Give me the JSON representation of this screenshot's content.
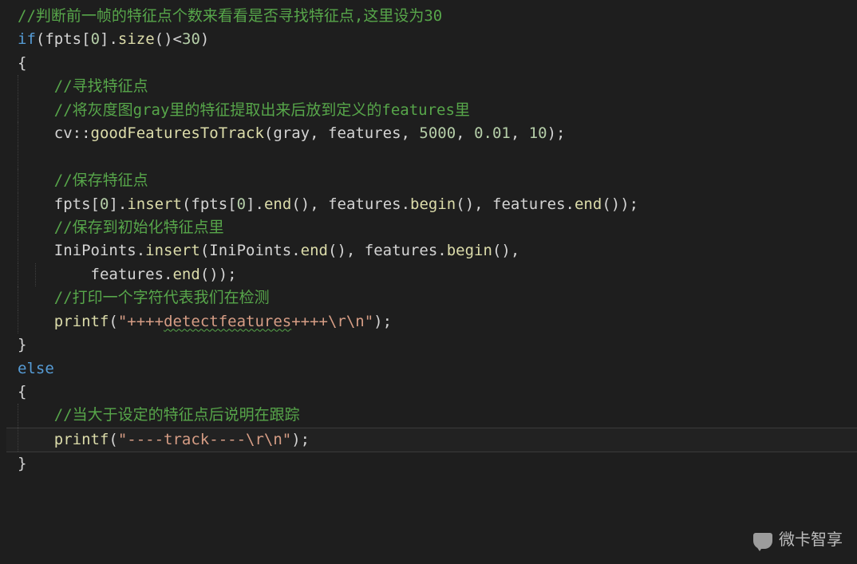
{
  "watermark": "微卡智享",
  "lines": [
    {
      "indent": 0,
      "tokens": [
        {
          "cls": "comment",
          "t": "//判断前一帧的特征点个数来看看是否寻找特征点,这里设为30"
        }
      ]
    },
    {
      "indent": 0,
      "tokens": [
        {
          "cls": "keyword",
          "t": "if"
        },
        {
          "cls": "punct",
          "t": "("
        },
        {
          "cls": "ident",
          "t": "fpts"
        },
        {
          "cls": "punct",
          "t": "["
        },
        {
          "cls": "number",
          "t": "0"
        },
        {
          "cls": "punct",
          "t": "]."
        },
        {
          "cls": "func",
          "t": "size"
        },
        {
          "cls": "punct",
          "t": "()<"
        },
        {
          "cls": "number",
          "t": "30"
        },
        {
          "cls": "punct",
          "t": ")"
        }
      ]
    },
    {
      "indent": 0,
      "tokens": [
        {
          "cls": "punct",
          "t": "{"
        }
      ]
    },
    {
      "indent": 1,
      "tokens": [
        {
          "cls": "comment",
          "t": "//寻找特征点"
        }
      ]
    },
    {
      "indent": 1,
      "tokens": [
        {
          "cls": "comment",
          "t": "//将灰度图gray里的特征提取出来后放到定义的features里"
        }
      ]
    },
    {
      "indent": 1,
      "tokens": [
        {
          "cls": "ident",
          "t": "cv"
        },
        {
          "cls": "punct",
          "t": "::"
        },
        {
          "cls": "func",
          "t": "goodFeaturesToTrack"
        },
        {
          "cls": "punct",
          "t": "("
        },
        {
          "cls": "ident",
          "t": "gray"
        },
        {
          "cls": "punct",
          "t": ", "
        },
        {
          "cls": "ident",
          "t": "features"
        },
        {
          "cls": "punct",
          "t": ", "
        },
        {
          "cls": "number",
          "t": "5000"
        },
        {
          "cls": "punct",
          "t": ", "
        },
        {
          "cls": "number",
          "t": "0.01"
        },
        {
          "cls": "punct",
          "t": ", "
        },
        {
          "cls": "number",
          "t": "10"
        },
        {
          "cls": "punct",
          "t": ");"
        }
      ]
    },
    {
      "indent": 1,
      "tokens": []
    },
    {
      "indent": 1,
      "tokens": [
        {
          "cls": "comment",
          "t": "//保存特征点"
        }
      ]
    },
    {
      "indent": 1,
      "tokens": [
        {
          "cls": "ident",
          "t": "fpts"
        },
        {
          "cls": "punct",
          "t": "["
        },
        {
          "cls": "number",
          "t": "0"
        },
        {
          "cls": "punct",
          "t": "]."
        },
        {
          "cls": "func",
          "t": "insert"
        },
        {
          "cls": "punct",
          "t": "("
        },
        {
          "cls": "ident",
          "t": "fpts"
        },
        {
          "cls": "punct",
          "t": "["
        },
        {
          "cls": "number",
          "t": "0"
        },
        {
          "cls": "punct",
          "t": "]."
        },
        {
          "cls": "func",
          "t": "end"
        },
        {
          "cls": "punct",
          "t": "(), "
        },
        {
          "cls": "ident",
          "t": "features"
        },
        {
          "cls": "punct",
          "t": "."
        },
        {
          "cls": "func",
          "t": "begin"
        },
        {
          "cls": "punct",
          "t": "(), "
        },
        {
          "cls": "ident",
          "t": "features"
        },
        {
          "cls": "punct",
          "t": "."
        },
        {
          "cls": "func",
          "t": "end"
        },
        {
          "cls": "punct",
          "t": "());"
        }
      ]
    },
    {
      "indent": 1,
      "tokens": [
        {
          "cls": "comment",
          "t": "//保存到初始化特征点里"
        }
      ]
    },
    {
      "indent": 1,
      "tokens": [
        {
          "cls": "ident",
          "t": "IniPoints"
        },
        {
          "cls": "punct",
          "t": "."
        },
        {
          "cls": "func",
          "t": "insert"
        },
        {
          "cls": "punct",
          "t": "("
        },
        {
          "cls": "ident",
          "t": "IniPoints"
        },
        {
          "cls": "punct",
          "t": "."
        },
        {
          "cls": "func",
          "t": "end"
        },
        {
          "cls": "punct",
          "t": "(), "
        },
        {
          "cls": "ident",
          "t": "features"
        },
        {
          "cls": "punct",
          "t": "."
        },
        {
          "cls": "func",
          "t": "begin"
        },
        {
          "cls": "punct",
          "t": "(),"
        }
      ]
    },
    {
      "indent": 2,
      "tokens": [
        {
          "cls": "ident",
          "t": "features"
        },
        {
          "cls": "punct",
          "t": "."
        },
        {
          "cls": "func",
          "t": "end"
        },
        {
          "cls": "punct",
          "t": "());"
        }
      ]
    },
    {
      "indent": 1,
      "tokens": [
        {
          "cls": "comment",
          "t": "//打印一个字符代表我们在检测"
        }
      ]
    },
    {
      "indent": 1,
      "tokens": [
        {
          "cls": "func",
          "t": "printf"
        },
        {
          "cls": "punct",
          "t": "("
        },
        {
          "cls": "string",
          "t": "\"++++"
        },
        {
          "cls": "string squiggle",
          "t": "detectfeatures"
        },
        {
          "cls": "string",
          "t": "++++\\r\\n\""
        },
        {
          "cls": "punct",
          "t": ");"
        }
      ]
    },
    {
      "indent": 0,
      "tokens": [
        {
          "cls": "punct",
          "t": "}"
        }
      ]
    },
    {
      "indent": 0,
      "tokens": [
        {
          "cls": "keyword",
          "t": "else"
        }
      ]
    },
    {
      "indent": 0,
      "tokens": [
        {
          "cls": "punct",
          "t": "{"
        }
      ]
    },
    {
      "indent": 1,
      "tokens": [
        {
          "cls": "comment",
          "t": "//当大于设定的特征点后说明在跟踪"
        }
      ]
    },
    {
      "indent": 1,
      "hl": true,
      "tokens": [
        {
          "cls": "func",
          "t": "printf"
        },
        {
          "cls": "punct",
          "t": "("
        },
        {
          "cls": "string",
          "t": "\"----track----\\r\\n\""
        },
        {
          "cls": "punct",
          "t": ");"
        }
      ]
    },
    {
      "indent": 0,
      "tokens": [
        {
          "cls": "punct",
          "t": "}"
        }
      ]
    }
  ]
}
